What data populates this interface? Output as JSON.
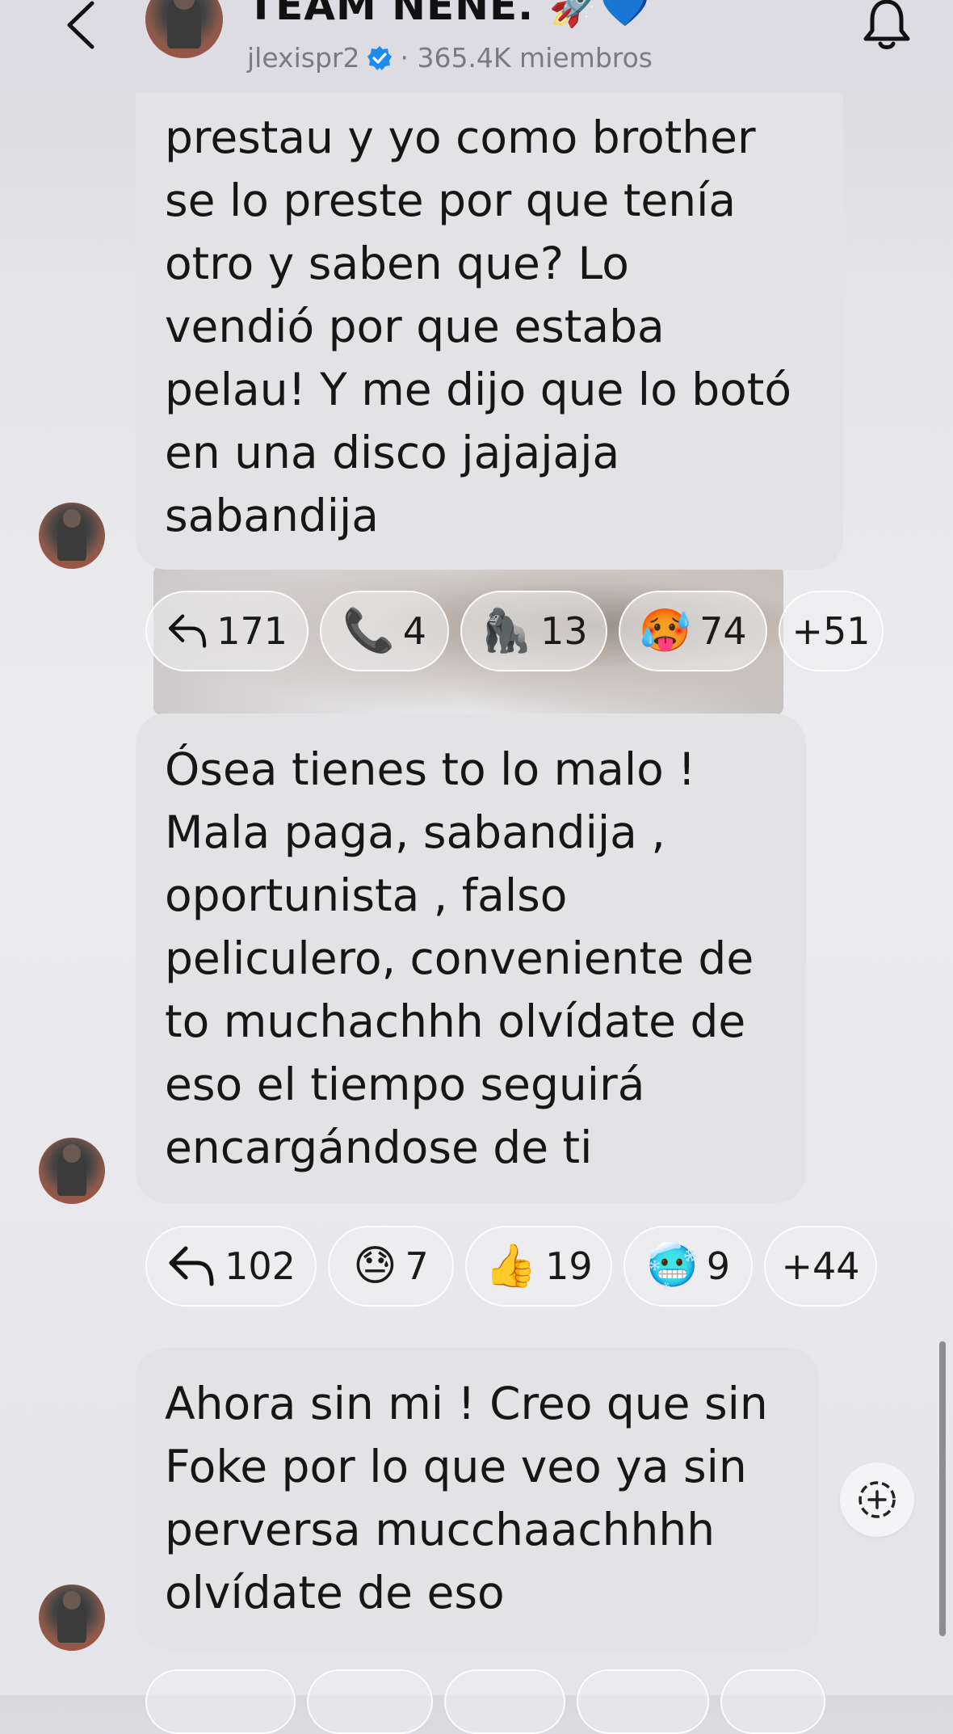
{
  "header": {
    "title": "TEAM NENE. 🚀💙",
    "handle": "jlexispr2",
    "members": "· 365.4K miembros"
  },
  "messages": [
    {
      "lines": [
        "prestau y yo como brother",
        "se lo preste por que tenía",
        "otro y saben que? Lo",
        "vendió por que estaba",
        "pelau! Y me dijo que lo botó",
        "en una disco jajajaja",
        "sabandija"
      ],
      "reactions": [
        {
          "icon": "reply",
          "count": "171"
        },
        {
          "emoji": "📞",
          "count": "4"
        },
        {
          "emoji": "🦍",
          "count": "13"
        },
        {
          "emoji": "🥵",
          "count": "74"
        },
        {
          "more": "+51"
        }
      ]
    },
    {
      "lines": [
        "Ósea tienes to lo malo !",
        "Mala paga, sabandija ,",
        "oportunista , falso",
        "peliculero, conveniente de",
        "to muchachhh olvídate de",
        "eso el tiempo seguirá",
        "encargándose de ti"
      ],
      "reactions": [
        {
          "icon": "reply",
          "count": "102"
        },
        {
          "emoji": "😓",
          "count": "7"
        },
        {
          "emoji": "👍",
          "count": "19"
        },
        {
          "emoji": "🥶",
          "count": "9"
        },
        {
          "more": "+44"
        }
      ]
    },
    {
      "lines": [
        "Ahora sin mi ! Creo que sin",
        "Foke por lo que veo ya sin",
        "perversa mucchaachhhh",
        "olvídate de eso"
      ]
    }
  ],
  "colors": {
    "bubble": "#e3e3e6",
    "verified": "#1d8cf0",
    "background": "#e8e8ec"
  },
  "icons": {
    "back": "chevron-left-icon",
    "bell": "bell-icon",
    "reply": "reply-icon",
    "compose": "add-circle-icon"
  }
}
